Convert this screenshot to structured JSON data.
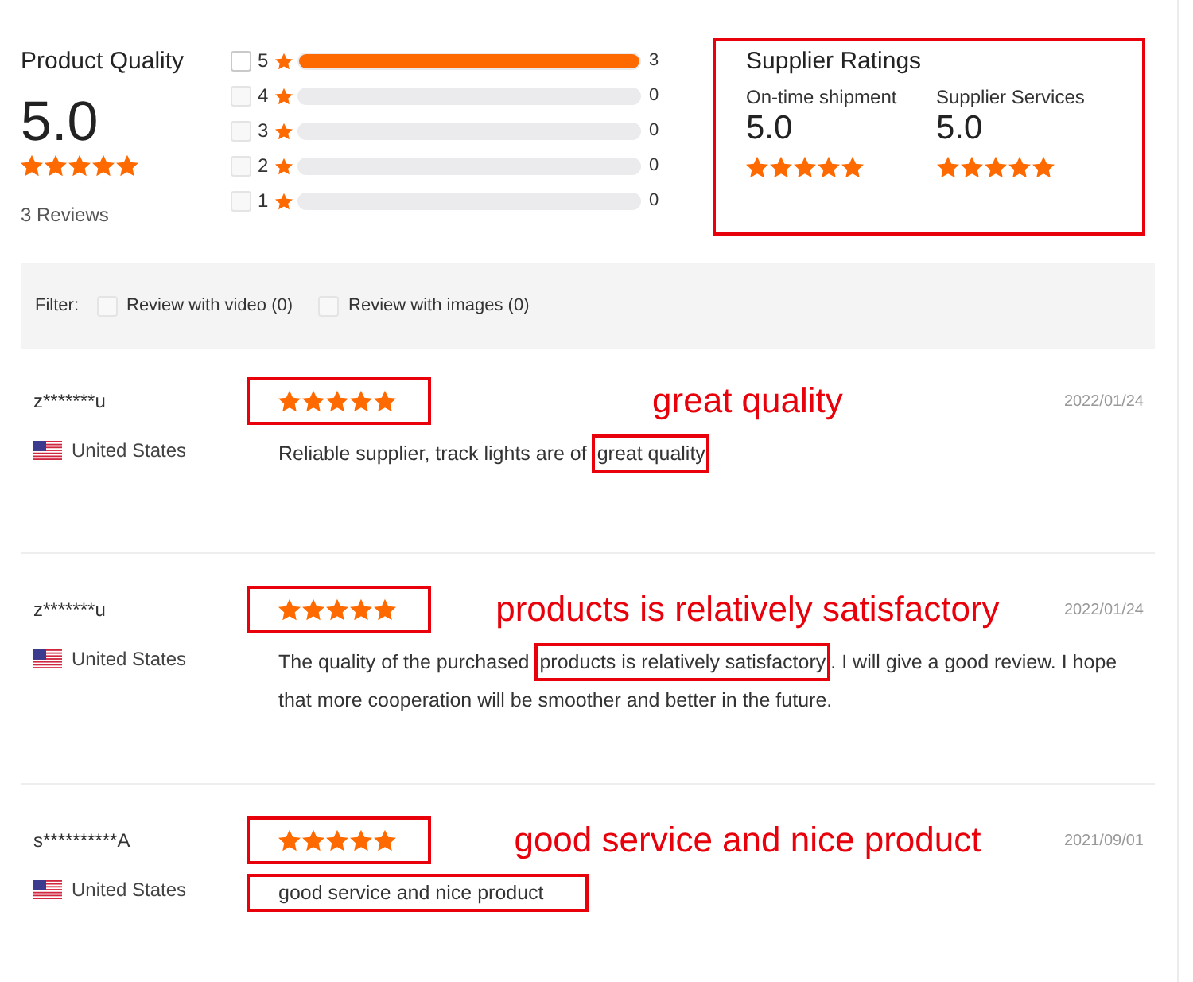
{
  "product_quality": {
    "title": "Product Quality",
    "score": "5.0",
    "stars": 5,
    "reviews_count": "3 Reviews"
  },
  "rating_breakdown": [
    {
      "label": "5",
      "checked": false,
      "disabled": false,
      "level": 1,
      "count": "3"
    },
    {
      "label": "4",
      "checked": false,
      "disabled": true,
      "level": 0,
      "count": "0"
    },
    {
      "label": "3",
      "checked": false,
      "disabled": true,
      "level": 0,
      "count": "0"
    },
    {
      "label": "2",
      "checked": false,
      "disabled": true,
      "level": 0,
      "count": "0"
    },
    {
      "label": "1",
      "checked": false,
      "disabled": true,
      "level": 0,
      "count": "0"
    }
  ],
  "supplier_ratings": {
    "title": "Supplier Ratings",
    "highlighted": true,
    "metrics": [
      {
        "label": "On-time shipment",
        "score": "5.0",
        "stars": 5
      },
      {
        "label": "Supplier Services",
        "score": "5.0",
        "stars": 5
      }
    ]
  },
  "filter": {
    "label": "Filter:",
    "options": [
      {
        "label": "Review with video (0)",
        "checked": false,
        "disabled": true
      },
      {
        "label": "Review with images (0)",
        "checked": false,
        "disabled": true
      }
    ]
  },
  "reviews": [
    {
      "user": "z*******u",
      "country": "United States",
      "stars": 5,
      "stars_highlighted": true,
      "annotation": "great quality",
      "date": "2022/01/24",
      "text_parts": [
        {
          "text": "Reliable supplier, track lights are of ",
          "highlighted": false
        },
        {
          "text": "great quality",
          "highlighted": true
        }
      ]
    },
    {
      "user": "z*******u",
      "country": "United States",
      "stars": 5,
      "stars_highlighted": true,
      "annotation": "products is relatively satisfactory",
      "date": "2022/01/24",
      "text_parts": [
        {
          "text": "The quality of the purchased ",
          "highlighted": false
        },
        {
          "text": "products is relatively satisfactory",
          "highlighted": true
        },
        {
          "text": ". I will give a good review. I hope that more cooperation will be smoother and better in the future.",
          "highlighted": false
        }
      ]
    },
    {
      "user": "s**********A",
      "country": "United States",
      "stars": 5,
      "stars_highlighted": true,
      "annotation": "good service and nice product",
      "date": "2021/09/01",
      "text_parts": [
        {
          "text": "good service and nice product",
          "highlighted": true
        }
      ]
    }
  ]
}
